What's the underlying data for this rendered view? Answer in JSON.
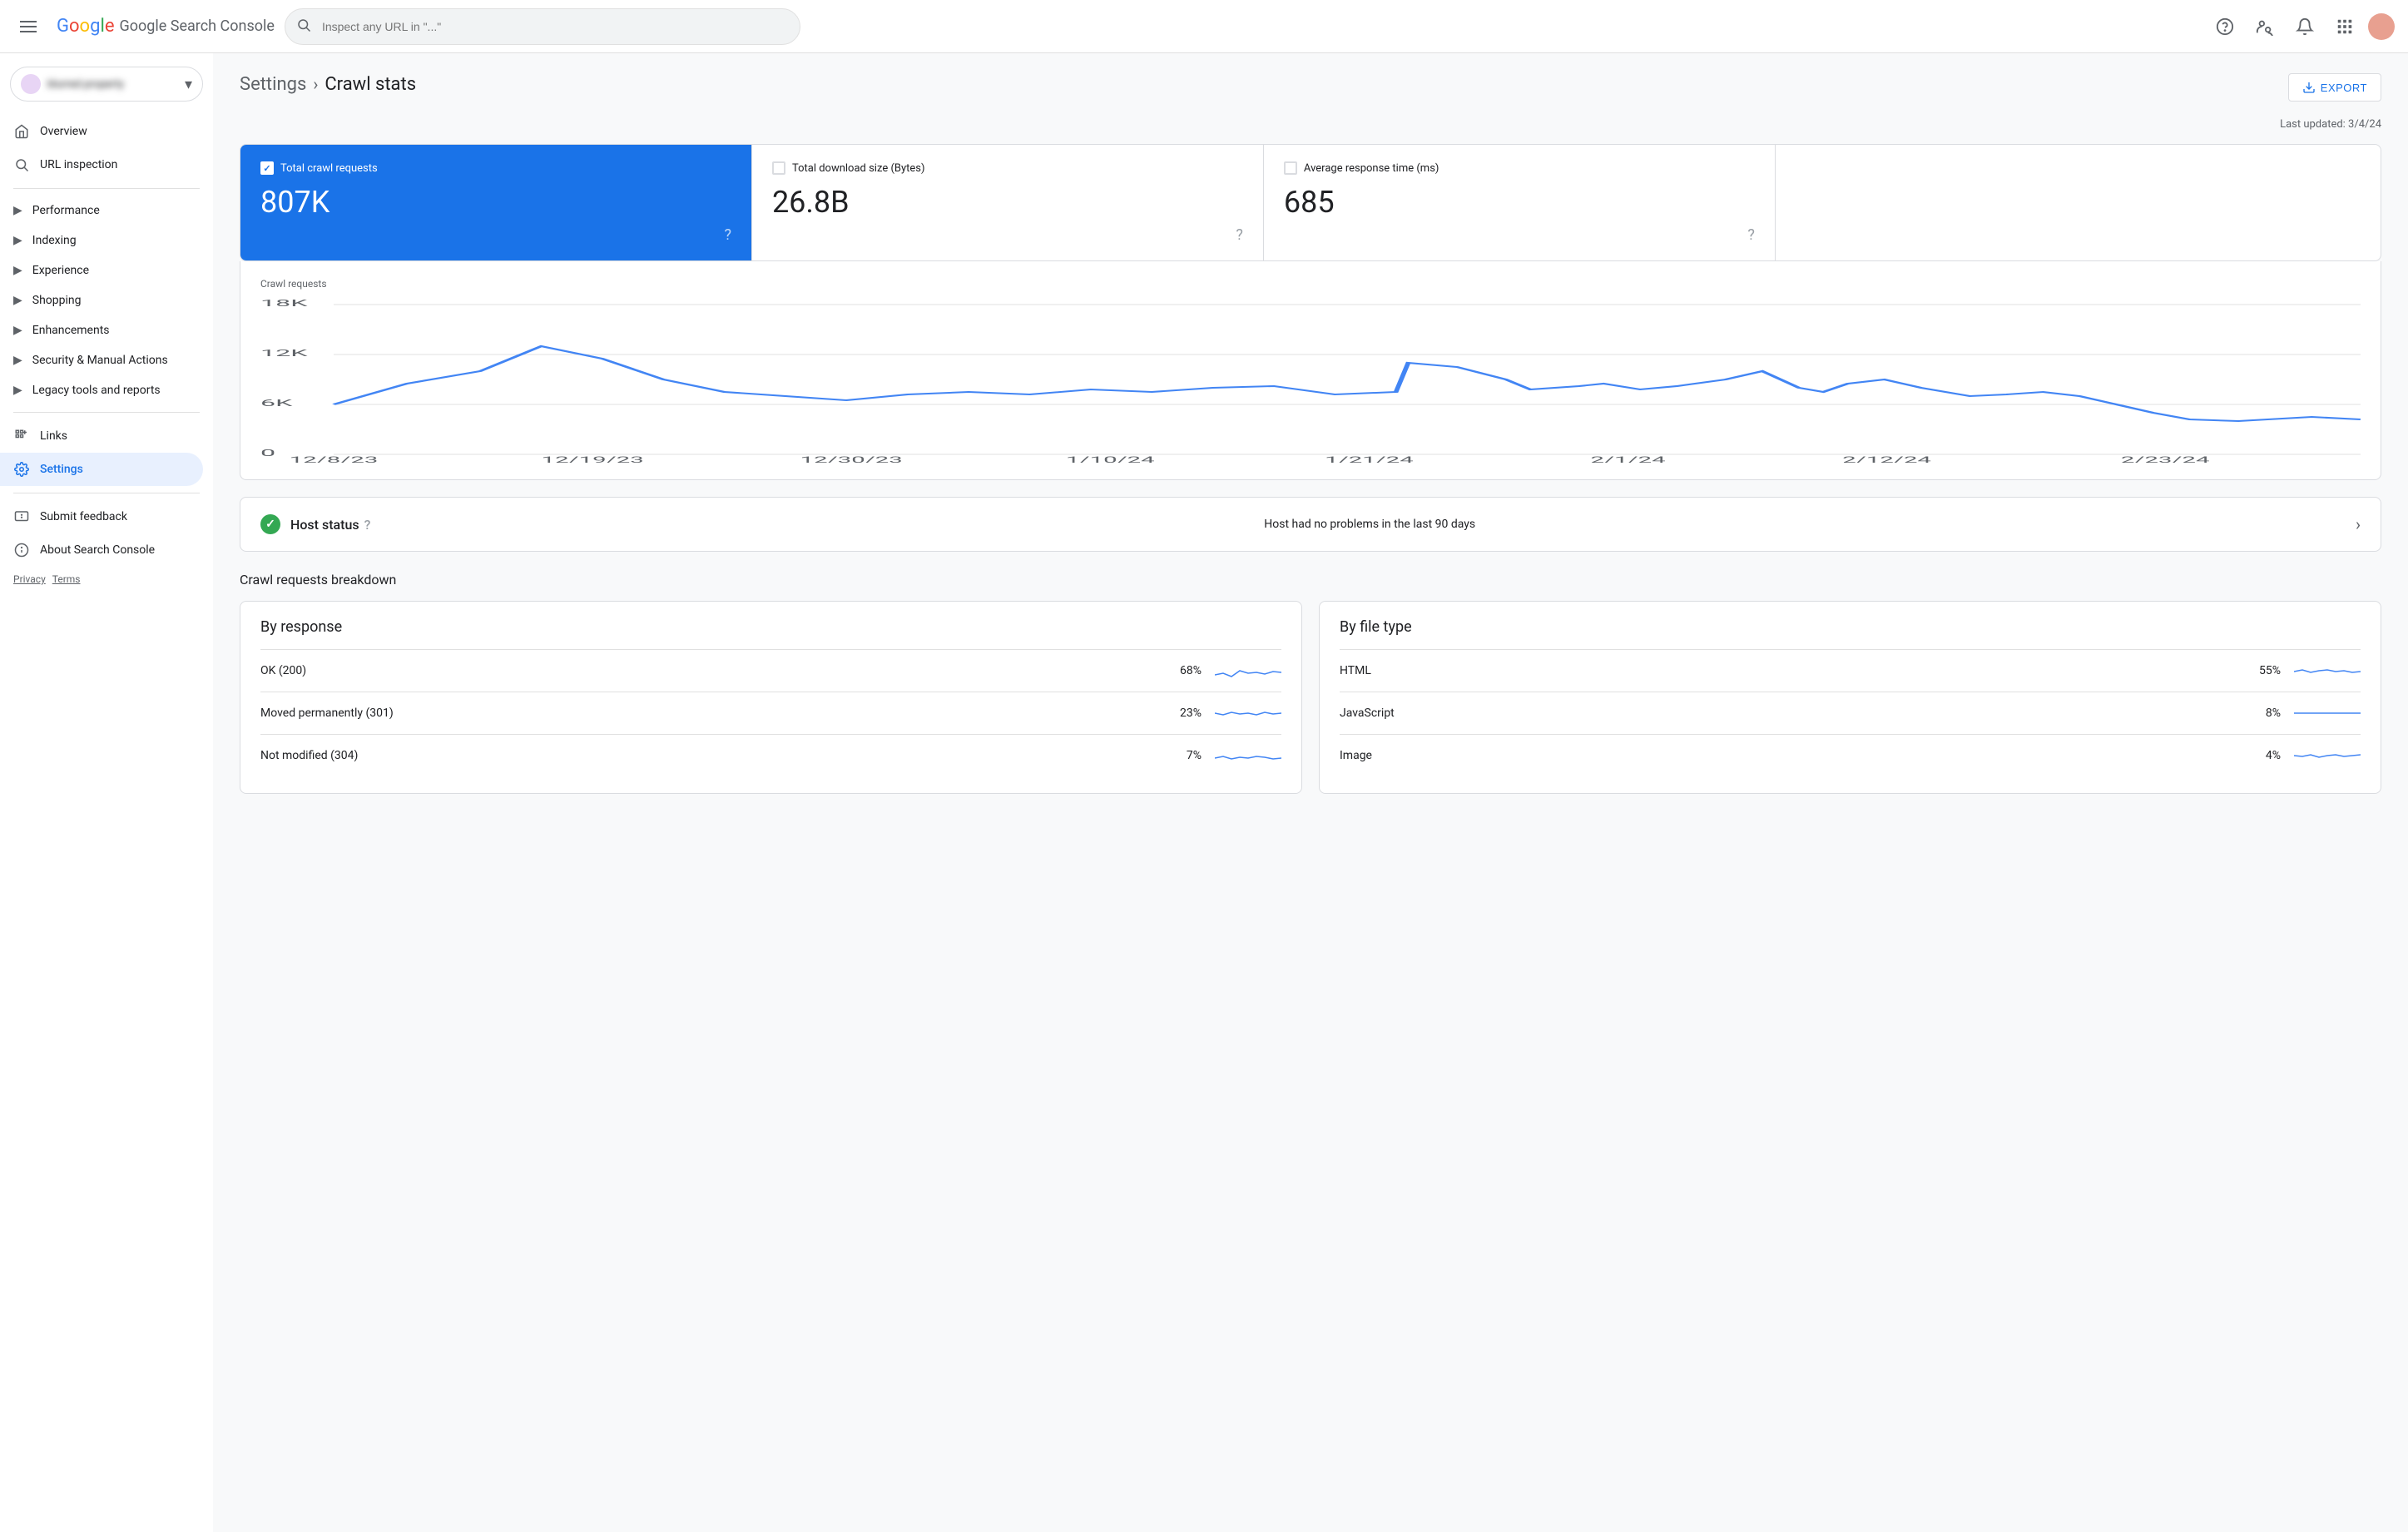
{
  "topbar": {
    "app_name": "Google Search Console",
    "search_placeholder": "Inspect any URL in \"...\"",
    "export_label": "EXPORT"
  },
  "breadcrumb": {
    "parent": "Settings",
    "current": "Crawl stats"
  },
  "last_updated": "Last updated: 3/4/24",
  "stats": [
    {
      "id": "total_crawl",
      "label": "Total crawl requests",
      "value": "807K",
      "active": true
    },
    {
      "id": "total_download",
      "label": "Total download size (Bytes)",
      "value": "26.8B",
      "active": false
    },
    {
      "id": "avg_response",
      "label": "Average response time (ms)",
      "value": "685",
      "active": false
    },
    {
      "id": "empty",
      "label": "",
      "value": "",
      "active": false
    }
  ],
  "chart": {
    "y_label": "Crawl requests",
    "y_axis": [
      "18K",
      "12K",
      "6K",
      "0"
    ],
    "x_axis": [
      "12/8/23",
      "12/19/23",
      "12/30/23",
      "1/10/24",
      "1/21/24",
      "2/1/24",
      "2/12/24",
      "2/23/24"
    ]
  },
  "host_status": {
    "title": "Host status",
    "description": "Host had no problems in the last 90 days"
  },
  "breakdown_section": {
    "title": "Crawl requests breakdown",
    "cards": [
      {
        "title": "By response",
        "rows": [
          {
            "label": "OK (200)",
            "pct": "68%",
            "spark_color": "#1a73e8"
          },
          {
            "label": "Moved permanently (301)",
            "pct": "23%",
            "spark_color": "#1a73e8"
          },
          {
            "label": "Not modified (304)",
            "pct": "7%",
            "spark_color": "#1a73e8"
          }
        ]
      },
      {
        "title": "By file type",
        "rows": [
          {
            "label": "HTML",
            "pct": "55%",
            "spark_color": "#1a73e8"
          },
          {
            "label": "JavaScript",
            "pct": "8%",
            "spark_color": "#1a73e8"
          },
          {
            "label": "Image",
            "pct": "4%",
            "spark_color": "#1a73e8"
          }
        ]
      }
    ]
  },
  "sidebar": {
    "property_label": "blurred-property",
    "items": [
      {
        "id": "overview",
        "label": "Overview",
        "icon": "home"
      },
      {
        "id": "url-inspection",
        "label": "URL inspection",
        "icon": "search"
      }
    ],
    "groups": [
      {
        "id": "performance",
        "label": "Performance",
        "icon": "chevron-right"
      },
      {
        "id": "indexing",
        "label": "Indexing",
        "icon": "chevron-right"
      },
      {
        "id": "experience",
        "label": "Experience",
        "icon": "chevron-right"
      },
      {
        "id": "shopping",
        "label": "Shopping",
        "icon": "chevron-right"
      },
      {
        "id": "enhancements",
        "label": "Enhancements",
        "icon": "chevron-right"
      },
      {
        "id": "security",
        "label": "Security & Manual Actions",
        "icon": "chevron-right"
      },
      {
        "id": "legacy",
        "label": "Legacy tools and reports",
        "icon": "chevron-right"
      }
    ],
    "bottom_items": [
      {
        "id": "links",
        "label": "Links",
        "icon": "links"
      },
      {
        "id": "settings",
        "label": "Settings",
        "icon": "settings",
        "active": true
      }
    ],
    "footer": [
      {
        "id": "submit-feedback",
        "label": "Submit feedback"
      },
      {
        "id": "about",
        "label": "About Search Console"
      }
    ],
    "privacy": "Privacy",
    "terms": "Terms"
  }
}
